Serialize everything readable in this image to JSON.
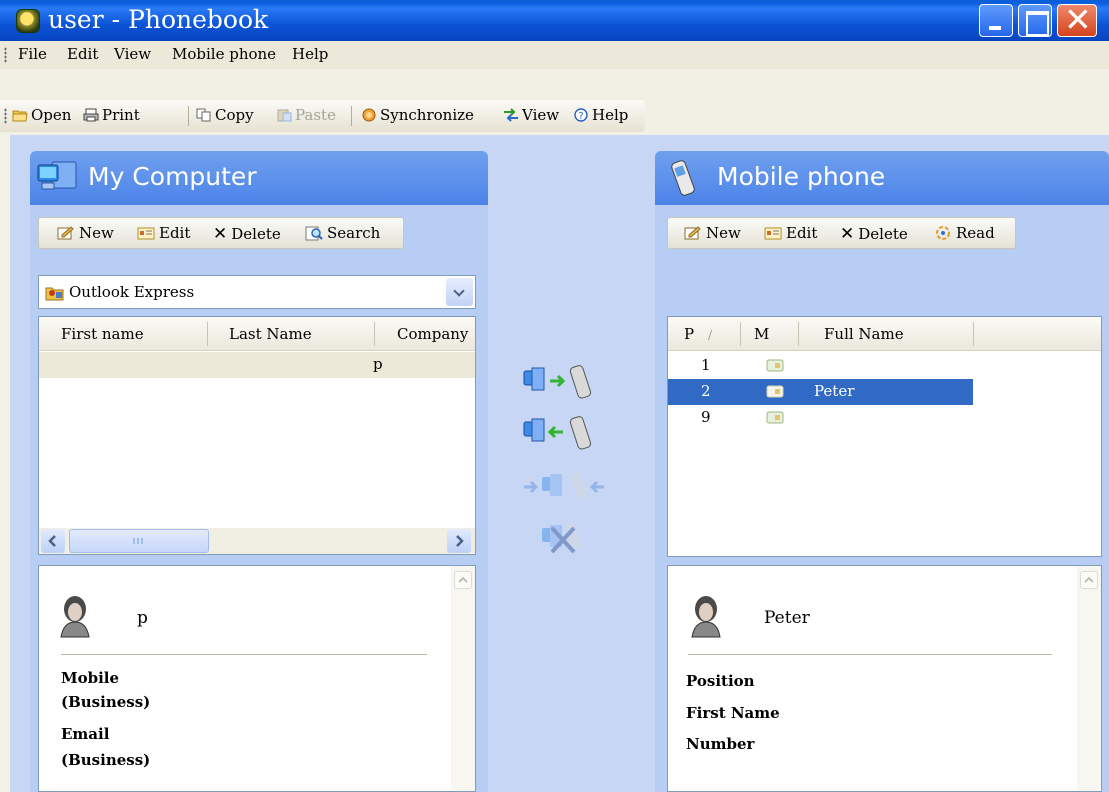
{
  "window": {
    "title": "user - Phonebook"
  },
  "menu": [
    "File",
    "Edit",
    "View",
    "Mobile phone",
    "Help"
  ],
  "toolbar": {
    "open": "Open",
    "print": "Print",
    "copy": "Copy",
    "paste": "Paste",
    "synchronize": "Synchronize",
    "view": "View",
    "help": "Help"
  },
  "left_panel": {
    "title": "My Computer",
    "tools": {
      "new": "New",
      "edit": "Edit",
      "delete": "Delete",
      "search": "Search"
    },
    "source": "Outlook Express",
    "columns": [
      "First name",
      "Last Name",
      "Company"
    ],
    "rows": [
      {
        "first_name": "",
        "last_name": "",
        "company": "p"
      }
    ],
    "detail": {
      "name": "p",
      "labels": [
        "Mobile",
        "(Business)",
        "Email",
        "(Business)"
      ]
    }
  },
  "right_panel": {
    "title": "Mobile phone",
    "tools": {
      "new": "New",
      "edit": "Edit",
      "delete": "Delete",
      "read": "Read"
    },
    "columns": [
      "P",
      "M",
      "Full Name"
    ],
    "rows": [
      {
        "position": "1",
        "name": ""
      },
      {
        "position": "2",
        "name": "Peter"
      },
      {
        "position": "9",
        "name": ""
      }
    ],
    "selected_row_index": 1,
    "detail": {
      "name": "Peter",
      "labels": [
        "Position",
        "First Name",
        "Number"
      ]
    }
  },
  "colors": {
    "title_bar": "#0b54d6",
    "panel_header": "#5a8fed",
    "selection": "#316ac5"
  }
}
